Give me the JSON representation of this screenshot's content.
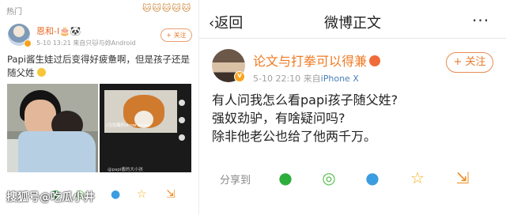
{
  "left": {
    "section_tag": "热门",
    "stickers": "🐱🐱🐱🐱🐱",
    "username": "恩和-I🎂🐼",
    "meta": "5-10 13:21  来自只🐱与妳Android",
    "follow_label": "+ 关注",
    "post_text": "Papi酱生娃过后变得好疲惫啊，但是孩子还是随父姓",
    "video_caption": "(马总踢的show time)",
    "video_watermark": "@papi酱的大小孩",
    "source_watermark": "搜狐号@吃瓜小井"
  },
  "right": {
    "back_label": "返回",
    "page_title": "微博正文",
    "more_icon": "···",
    "username": "论文与打拳可以得兼",
    "time": "5-10 22:10",
    "source_prefix": "来自",
    "source_device": "iPhone X",
    "follow_label": "+ 关注",
    "body_lines": [
      "有人问我怎么看papi孩子随父姓?",
      "强奴劲驴，有啥疑问吗?",
      "除非他老公也给了他两千万。"
    ],
    "share_label": "分享到"
  },
  "colors": {
    "accent_orange": "#e8792c",
    "link_blue": "#4a7ebb",
    "wechat_green": "#2dae3c",
    "moments_green": "#55c04b",
    "qq_blue": "#3a9de0",
    "star_yellow": "#f5b21a",
    "download_orange": "#f08c1f"
  },
  "icons": {
    "share": [
      "wechat-icon",
      "moments-icon",
      "qq-icon",
      "favorite-star-icon",
      "download-icon"
    ]
  }
}
